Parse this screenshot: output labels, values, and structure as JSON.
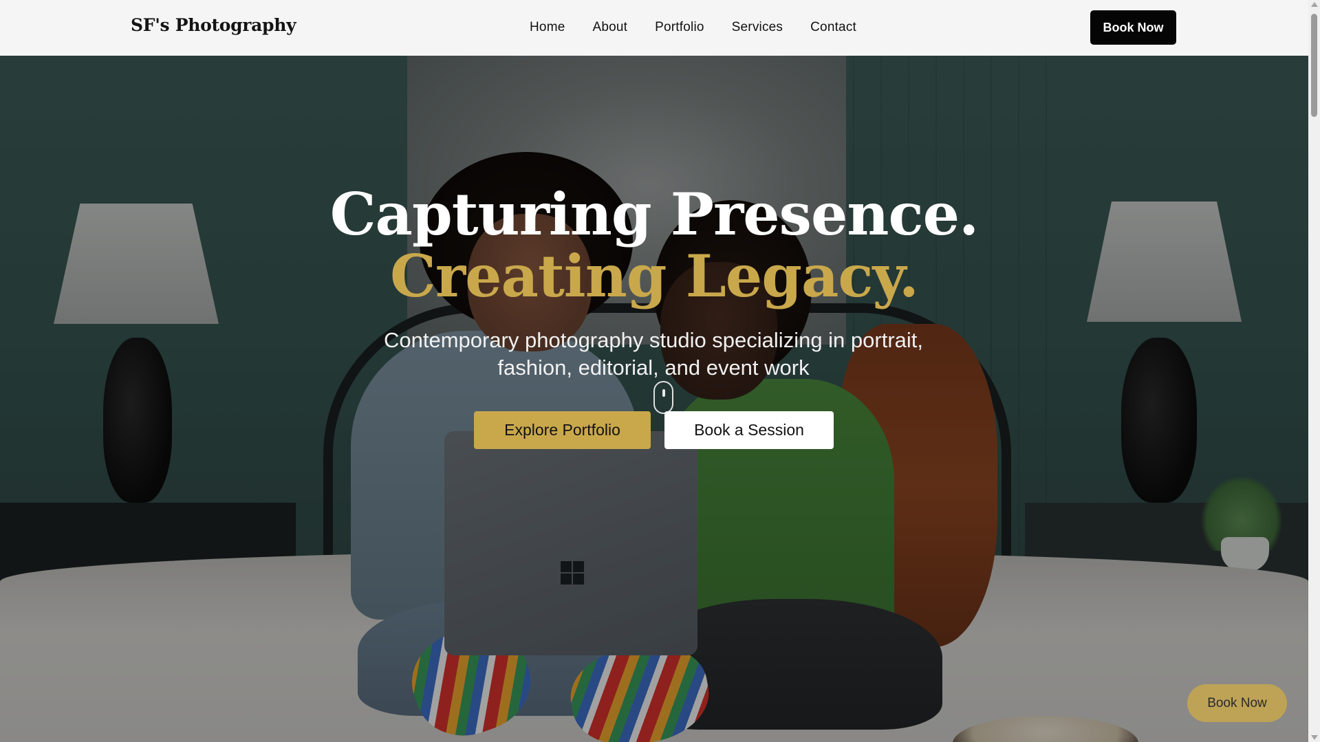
{
  "header": {
    "brand": "SF's Photography",
    "nav": [
      "Home",
      "About",
      "Portfolio",
      "Services",
      "Contact"
    ],
    "book_now": "Book Now"
  },
  "hero": {
    "title_line1": "Capturing Presence.",
    "title_line2": "Creating Legacy.",
    "subtitle": "Contemporary photography studio specializing in portrait, fashion, editorial, and event work",
    "primary_cta": "Explore Portfolio",
    "secondary_cta": "Book a Session",
    "scroll_icon": "mouse-scroll-icon",
    "background_image": "two-women-on-bed-with-laptop"
  },
  "floating_cta": {
    "label": "Book Now"
  },
  "colors": {
    "accent_gold": "#c9a84c",
    "header_bg": "#f4f5f4",
    "button_dark": "#050505"
  }
}
